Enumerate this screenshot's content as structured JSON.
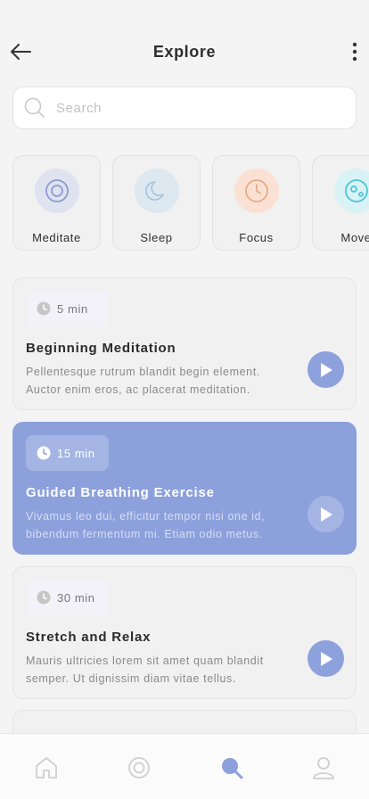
{
  "header": {
    "title": "Explore"
  },
  "search": {
    "placeholder": "Search"
  },
  "categories": [
    {
      "label": "Meditate",
      "icon": "meditate-icon",
      "bubble": "#dfe2ef",
      "color": "#8c9cd2"
    },
    {
      "label": "Sleep",
      "icon": "moon-icon",
      "bubble": "#dde8f1",
      "color": "#a7c1dc"
    },
    {
      "label": "Focus",
      "icon": "clock-icon",
      "bubble": "#fae1d3",
      "color": "#e8a47b"
    },
    {
      "label": "Move",
      "icon": "move-icon",
      "bubble": "#d9f2f5",
      "color": "#4dc6d6"
    }
  ],
  "sessions": [
    {
      "duration": "5 min",
      "title": "Beginning Meditation",
      "description": "Pellentesque rutrum blandit begin element. Auctor enim eros, ac placerat meditation.",
      "active": false
    },
    {
      "duration": "15 min",
      "title": "Guided Breathing Exercise",
      "description": "Vivamus leo dui, efficitur tempor nisi one id, bibendum fermentum mi. Etiam odio metus.",
      "active": true
    },
    {
      "duration": "30 min",
      "title": "Stretch and Relax",
      "description": "Mauris ultricies lorem sit amet quam blandit semper. Ut dignissim diam vitae tellus.",
      "active": false
    }
  ],
  "bottom_nav": [
    {
      "icon": "home-icon",
      "active": false
    },
    {
      "icon": "meditate-icon",
      "active": false
    },
    {
      "icon": "search-icon",
      "active": true
    },
    {
      "icon": "profile-icon",
      "active": false
    }
  ],
  "colors": {
    "accent": "#8ca0dc",
    "nav_active": "#8ca0dc",
    "nav_inactive": "#cfcfcf"
  }
}
